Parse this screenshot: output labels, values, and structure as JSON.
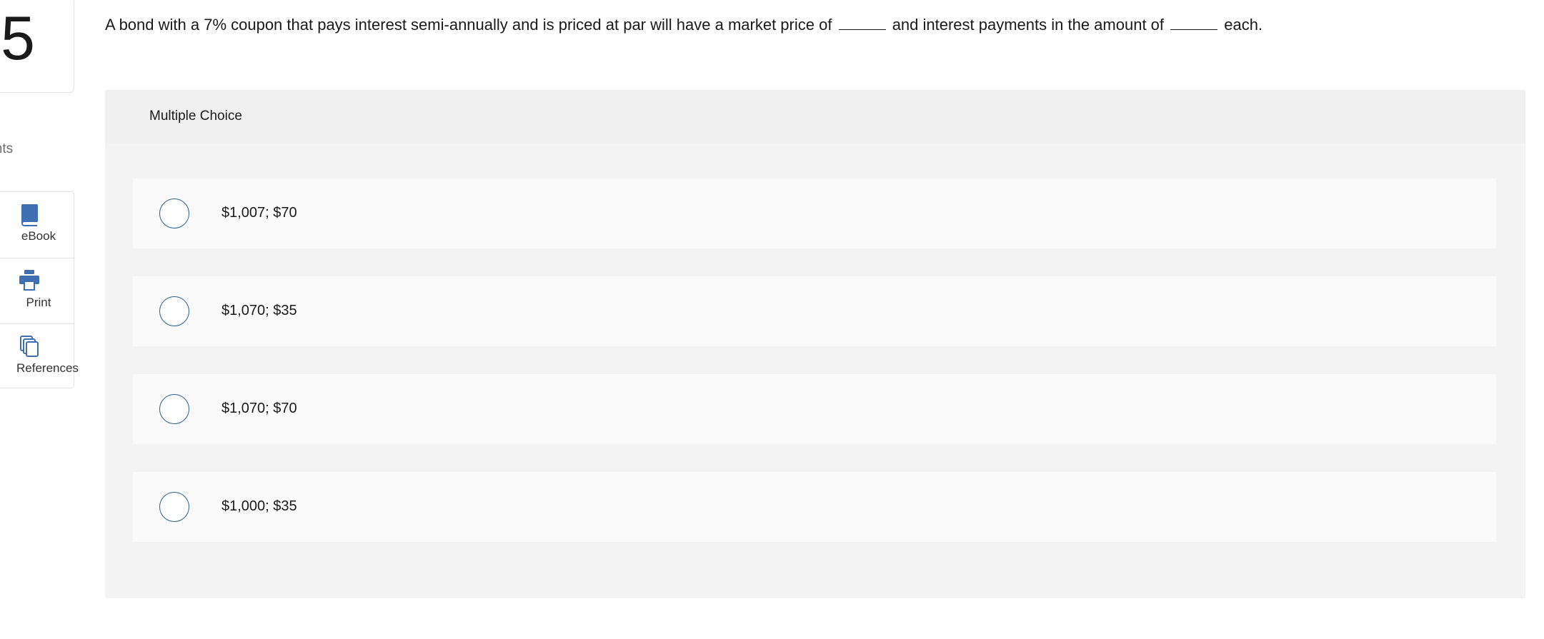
{
  "question": {
    "number": "5",
    "points_label": "oints",
    "text_part1": "A bond with a 7% coupon that pays interest semi-annually and is priced at par will have a market price of",
    "text_part2": "and interest payments in the amount of",
    "text_part3": "each."
  },
  "tools": [
    {
      "label": "eBook",
      "icon": "book-icon"
    },
    {
      "label": "Print",
      "icon": "printer-icon"
    },
    {
      "label": "References",
      "icon": "copy-documents-icon"
    }
  ],
  "panel": {
    "title": "Multiple Choice",
    "choices": [
      {
        "label": "$1,007; $70"
      },
      {
        "label": "$1,070; $35"
      },
      {
        "label": "$1,070; $70"
      },
      {
        "label": "$1,000; $35"
      }
    ]
  },
  "colors": {
    "accent": "#2b5f8c",
    "icon": "#3f6fb0",
    "panel_bg": "#f3f3f3",
    "choice_bg": "#fafafa"
  }
}
